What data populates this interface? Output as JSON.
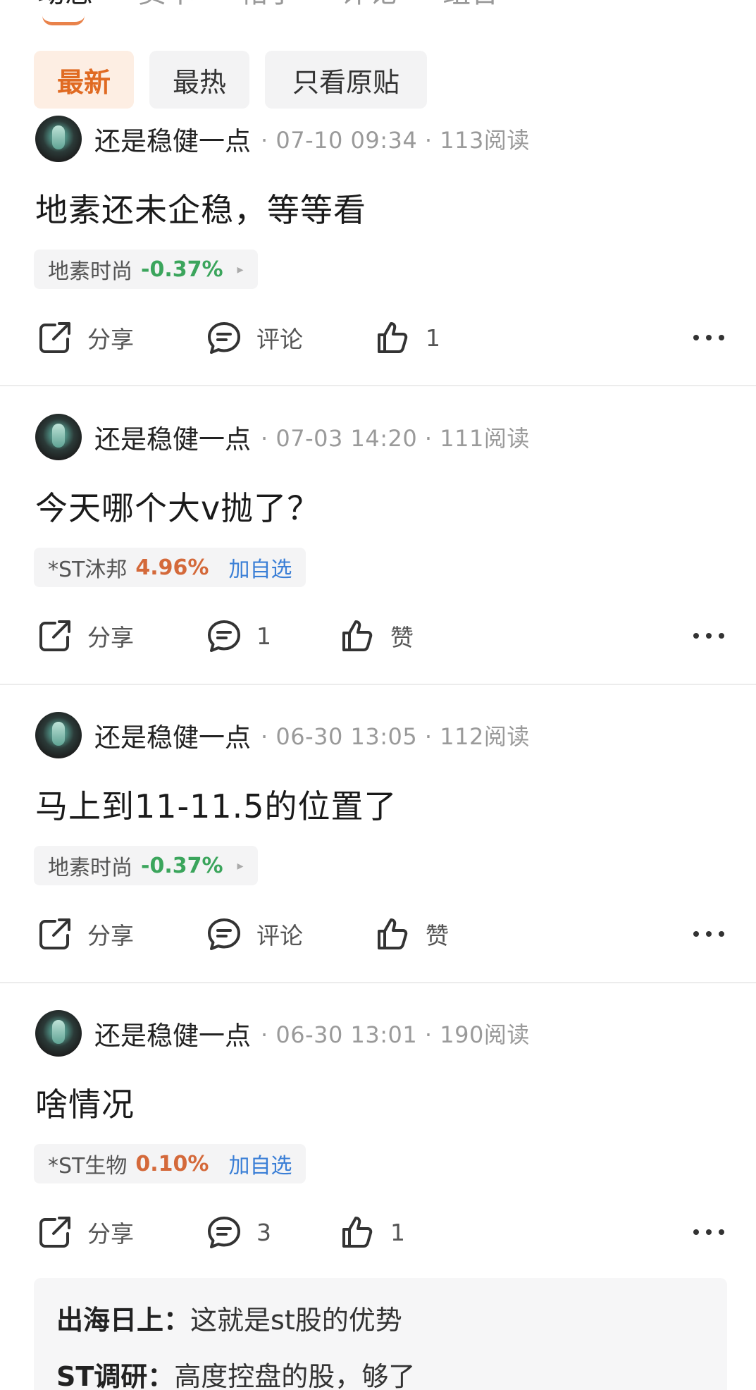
{
  "top_tabs": [
    "动态",
    "资本",
    "帖子",
    "评论",
    "组合"
  ],
  "filters": [
    {
      "label": "最新",
      "active": true
    },
    {
      "label": "最热",
      "active": false
    },
    {
      "label": "只看原贴",
      "active": false
    }
  ],
  "posts": [
    {
      "username": "还是稳健一点",
      "meta": "· 07-10 09:34 · 113阅读",
      "text": "地素还未企稳，等等看",
      "stock": {
        "name": "地素时尚",
        "change": "-0.37%",
        "direction": "down",
        "arrow": "▸",
        "add": ""
      },
      "share": "分享",
      "comment": "评论",
      "like": "1"
    },
    {
      "username": "还是稳健一点",
      "meta": "· 07-03 14:20 · 111阅读",
      "text": "今天哪个大v抛了？",
      "stock": {
        "name": "*ST沐邦",
        "change": "4.96%",
        "direction": "up",
        "arrow": "",
        "add": "加自选"
      },
      "share": "分享",
      "comment": "1",
      "like": "赞"
    },
    {
      "username": "还是稳健一点",
      "meta": "· 06-30 13:05 · 112阅读",
      "text": "马上到11-11.5的位置了",
      "stock": {
        "name": "地素时尚",
        "change": "-0.37%",
        "direction": "down",
        "arrow": "▸",
        "add": ""
      },
      "share": "分享",
      "comment": "评论",
      "like": "赞"
    },
    {
      "username": "还是稳健一点",
      "meta": "· 06-30 13:01 · 190阅读",
      "text": "啥情况",
      "stock": {
        "name": "*ST生物",
        "change": "0.10%",
        "direction": "up",
        "arrow": "",
        "add": "加自选"
      },
      "share": "分享",
      "comment": "3",
      "like": "1"
    }
  ],
  "replies": [
    {
      "author": "出海日上：",
      "text": "这就是st股的优势"
    },
    {
      "author": "ST调研：",
      "text": "高度控盘的股，够了"
    }
  ],
  "colors": {
    "accent": "#e06a22",
    "down": "#3ba55c",
    "up": "#d4693a",
    "link": "#3b7fd6"
  },
  "icons": {
    "share": "share-icon",
    "comment": "comment-icon",
    "like": "thumbs-up-icon",
    "more": "more-icon"
  }
}
